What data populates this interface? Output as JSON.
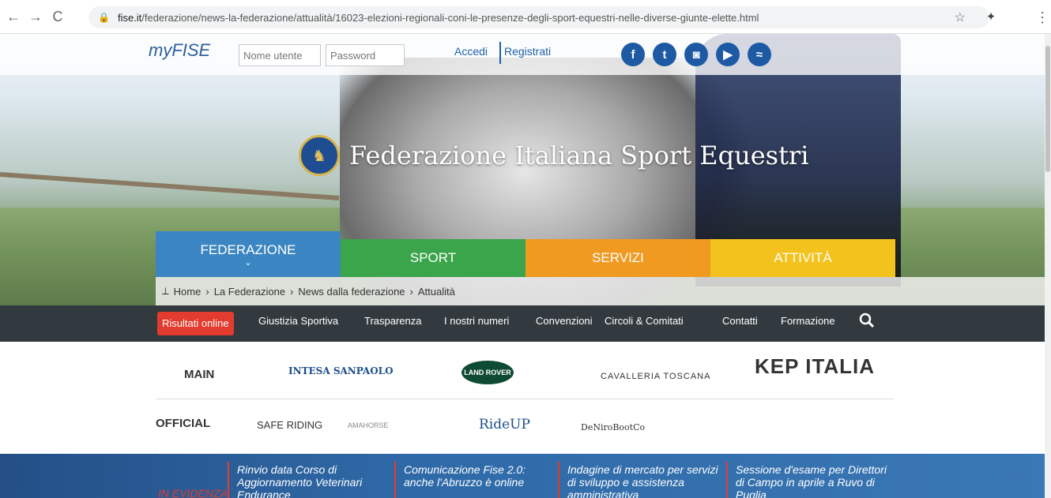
{
  "browser": {
    "url_host": "fise.it",
    "url_path": "/federazione/news-la-federazione/attualità/16023-elezioni-regionali-coni-le-presenze-degli-sport-equestri-nelle-diverse-giunte-elette.html"
  },
  "topbar": {
    "brand": "myFISE",
    "username_placeholder": "Nome utente",
    "password_placeholder": "Password",
    "login": "Accedi",
    "register": "Registrati",
    "social": [
      {
        "icon": "facebook-icon",
        "glyph": "f",
        "color": "#1e5aa4"
      },
      {
        "icon": "twitter-icon",
        "glyph": "t",
        "color": "#1e5aa4"
      },
      {
        "icon": "instagram-icon",
        "glyph": "◙",
        "color": "#1e5aa4"
      },
      {
        "icon": "youtube-icon",
        "glyph": "▶",
        "color": "#1e5aa4"
      },
      {
        "icon": "rss-icon",
        "glyph": "≈",
        "color": "#1e5aa4"
      }
    ]
  },
  "hero": {
    "title": "Federazione Italiana Sport Equestri"
  },
  "menu": [
    {
      "label": "FEDERAZIONE",
      "color": "#3b86c2",
      "active": true
    },
    {
      "label": "SPORT",
      "color": "#3aa54a",
      "active": false
    },
    {
      "label": "SERVIZI",
      "color": "#f09a22",
      "active": false
    },
    {
      "label": "ATTIVITÀ",
      "color": "#f3c21c",
      "active": false
    }
  ],
  "breadcrumb": [
    "Home",
    "La Federazione",
    "News dalla federazione",
    "Attualità"
  ],
  "subnav": {
    "highlight": "Risultati online",
    "items": [
      "Giustizia Sportiva",
      "Trasparenza",
      "I nostri numeri",
      "Convenzioni",
      "Circoli & Comitati",
      "Contatti",
      "Formazione"
    ]
  },
  "sponsors": {
    "main_label": "MAIN",
    "official_label": "OFFICIAL",
    "main": [
      "INTESA SANPAOLO",
      "LAND ROVER",
      "CAVALLERIA TOSCANA",
      "KEP ITALIA"
    ],
    "official": [
      "SAFE RIDING",
      "AMAHORSE",
      "RideUP",
      "DeNiroBootCo"
    ]
  },
  "news": {
    "label": "IN EVIDENZA",
    "items": [
      "Rinvio data Corso di Aggiornamento Veterinari Endurance",
      "Comunicazione Fise 2.0: anche l'Abruzzo è online",
      "Indagine di mercato per servizi di sviluppo e assistenza amministrativa",
      "Sessione d'esame per Direttori di Campo in aprile a Ruvo di Puglia"
    ]
  }
}
